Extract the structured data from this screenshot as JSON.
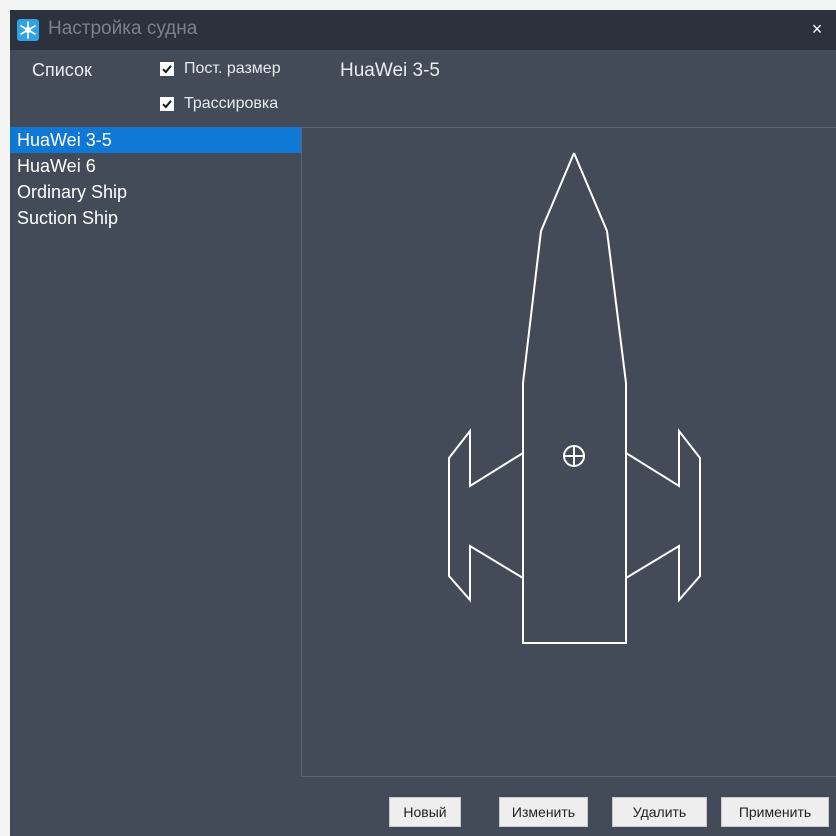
{
  "window": {
    "title": "Настройка судна",
    "close_glyph": "×"
  },
  "list_label": "Список",
  "options": {
    "fixed_size": {
      "label": "Пост. размер",
      "checked": true
    },
    "tracing": {
      "label": "Трассировка",
      "checked": true
    }
  },
  "selected_ship_title": "HuaWei 3-5",
  "ships": [
    {
      "name": "HuaWei 3-5",
      "selected": true
    },
    {
      "name": "HuaWei 6",
      "selected": false
    },
    {
      "name": "Ordinary Ship",
      "selected": false
    },
    {
      "name": "Suction Ship",
      "selected": false
    }
  ],
  "buttons": {
    "new": "Новый",
    "edit": "Изменить",
    "delete": "Удалить",
    "apply": "Применить"
  },
  "colors": {
    "panel_bg": "#434b58",
    "titlebar_bg": "#2c323c",
    "selection": "#0f78d7",
    "ship_outline": "#ffffff"
  },
  "icons": {
    "app": "snowflake-icon",
    "close": "close-icon",
    "checkbox": "checkmark-icon",
    "center": "crosshair-icon"
  }
}
